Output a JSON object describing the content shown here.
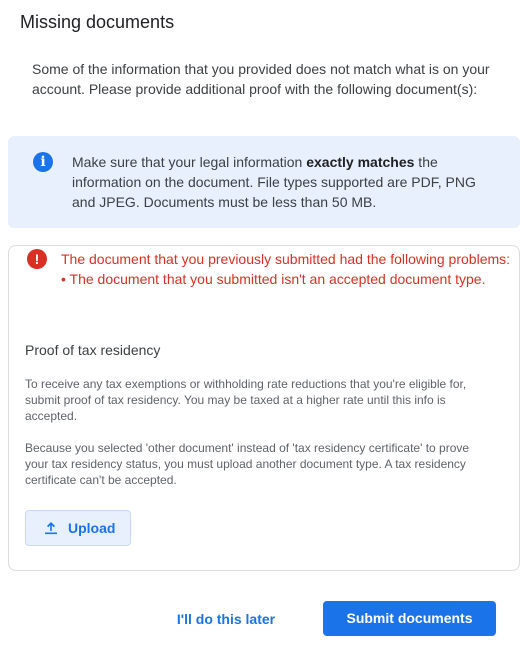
{
  "dialog": {
    "title": "Missing documents",
    "intro": "Some of the information that you provided does not match what is on your account. Please provide additional proof with the following document(s):"
  },
  "info": {
    "icon": "info-icon",
    "text_before": "Make sure that your legal information ",
    "text_bold": "exactly matches",
    "text_after": " the information on the document. File types supported are PDF, PNG and JPEG. Documents must be less than 50 MB."
  },
  "error": {
    "icon": "error-icon",
    "headline": "The document that you previously submitted had the following problems:",
    "item": "• The document that you submitted isn't an accepted document type."
  },
  "section": {
    "title": "Proof of tax residency",
    "para1": "To receive any tax exemptions or withholding rate reductions that you're eligible for, submit proof of tax residency. You may be taxed at a higher rate until this info is accepted.",
    "para2": "Because you selected 'other document' instead of 'tax residency certificate' to prove your tax residency status, you must upload another document type. A tax residency certificate can't be accepted.",
    "upload_label": "Upload",
    "upload_icon": "upload-icon"
  },
  "footer": {
    "later_label": "I'll do this later",
    "submit_label": "Submit documents"
  },
  "colors": {
    "accent": "#1a73e8",
    "error": "#d93025",
    "info_bg": "#e8f0fe"
  }
}
